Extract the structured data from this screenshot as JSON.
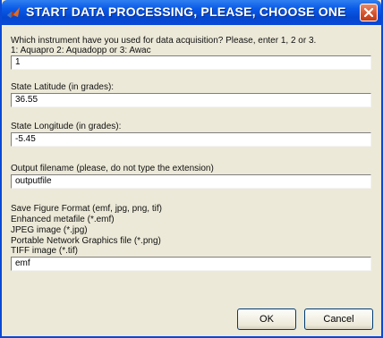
{
  "window": {
    "title": "START DATA PROCESSING, PLEASE, CHOOSE ONE OF TH...",
    "app_icon": "matlab-icon",
    "close_icon": "close-icon"
  },
  "instrument": {
    "prompt_line1": "Which instrument have you used for data acquisition?  Please, enter 1, 2 or 3.",
    "prompt_line2": "1: Aquapro    2: Aquadopp    or    3: Awac",
    "value": "1"
  },
  "latitude": {
    "label": "State Latitude (in grades):",
    "value": "36.55"
  },
  "longitude": {
    "label": "State Longitude (in grades):",
    "value": "-5.45"
  },
  "output": {
    "label": "Output filename (please, do not type the extension)",
    "value": "outputfile"
  },
  "figure_format": {
    "lines": [
      "Save Figure Format (emf, jpg, png, tif)",
      "Enhanced metafile (*.emf)",
      "JPEG image (*.jpg)",
      "Portable Network Graphics file (*.png)",
      "TIFF image  (*.tif)"
    ],
    "value": "emf"
  },
  "buttons": {
    "ok": "OK",
    "cancel": "Cancel"
  },
  "colors": {
    "title_bar": "#0a49d6",
    "dialog_bg": "#ece9d8",
    "close_button": "#d4502c"
  }
}
